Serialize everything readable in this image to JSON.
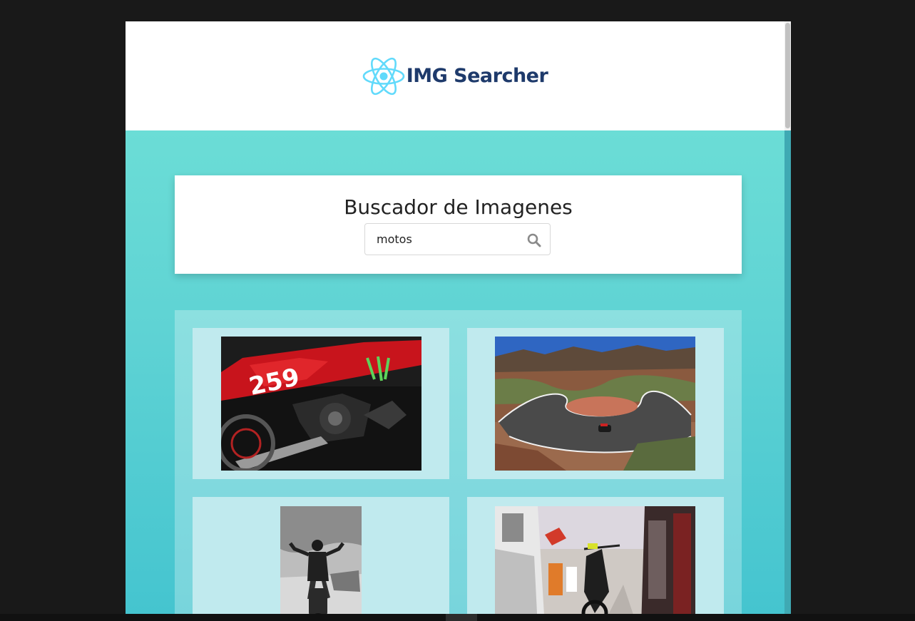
{
  "header": {
    "app_name": "IMG Searcher",
    "logo_icon": "react-atom-icon",
    "logo_color": "#61dafb",
    "title_color": "#1e3a6b"
  },
  "search": {
    "title": "Buscador de Imagenes",
    "value": "motos",
    "icon": "search-icon"
  },
  "results": [
    {
      "alt": "Red motocross bike 259"
    },
    {
      "alt": "Motorcycle on winding mountain road"
    },
    {
      "alt": "Rider on motorcycle, black and white"
    },
    {
      "alt": "Dirt bike between trucks in paddock"
    }
  ],
  "colors": {
    "page_background": "#191919",
    "body_gradient_top": "#6bddd6",
    "body_gradient_bottom": "#44c4cf",
    "card_background": "#c0eaee"
  }
}
